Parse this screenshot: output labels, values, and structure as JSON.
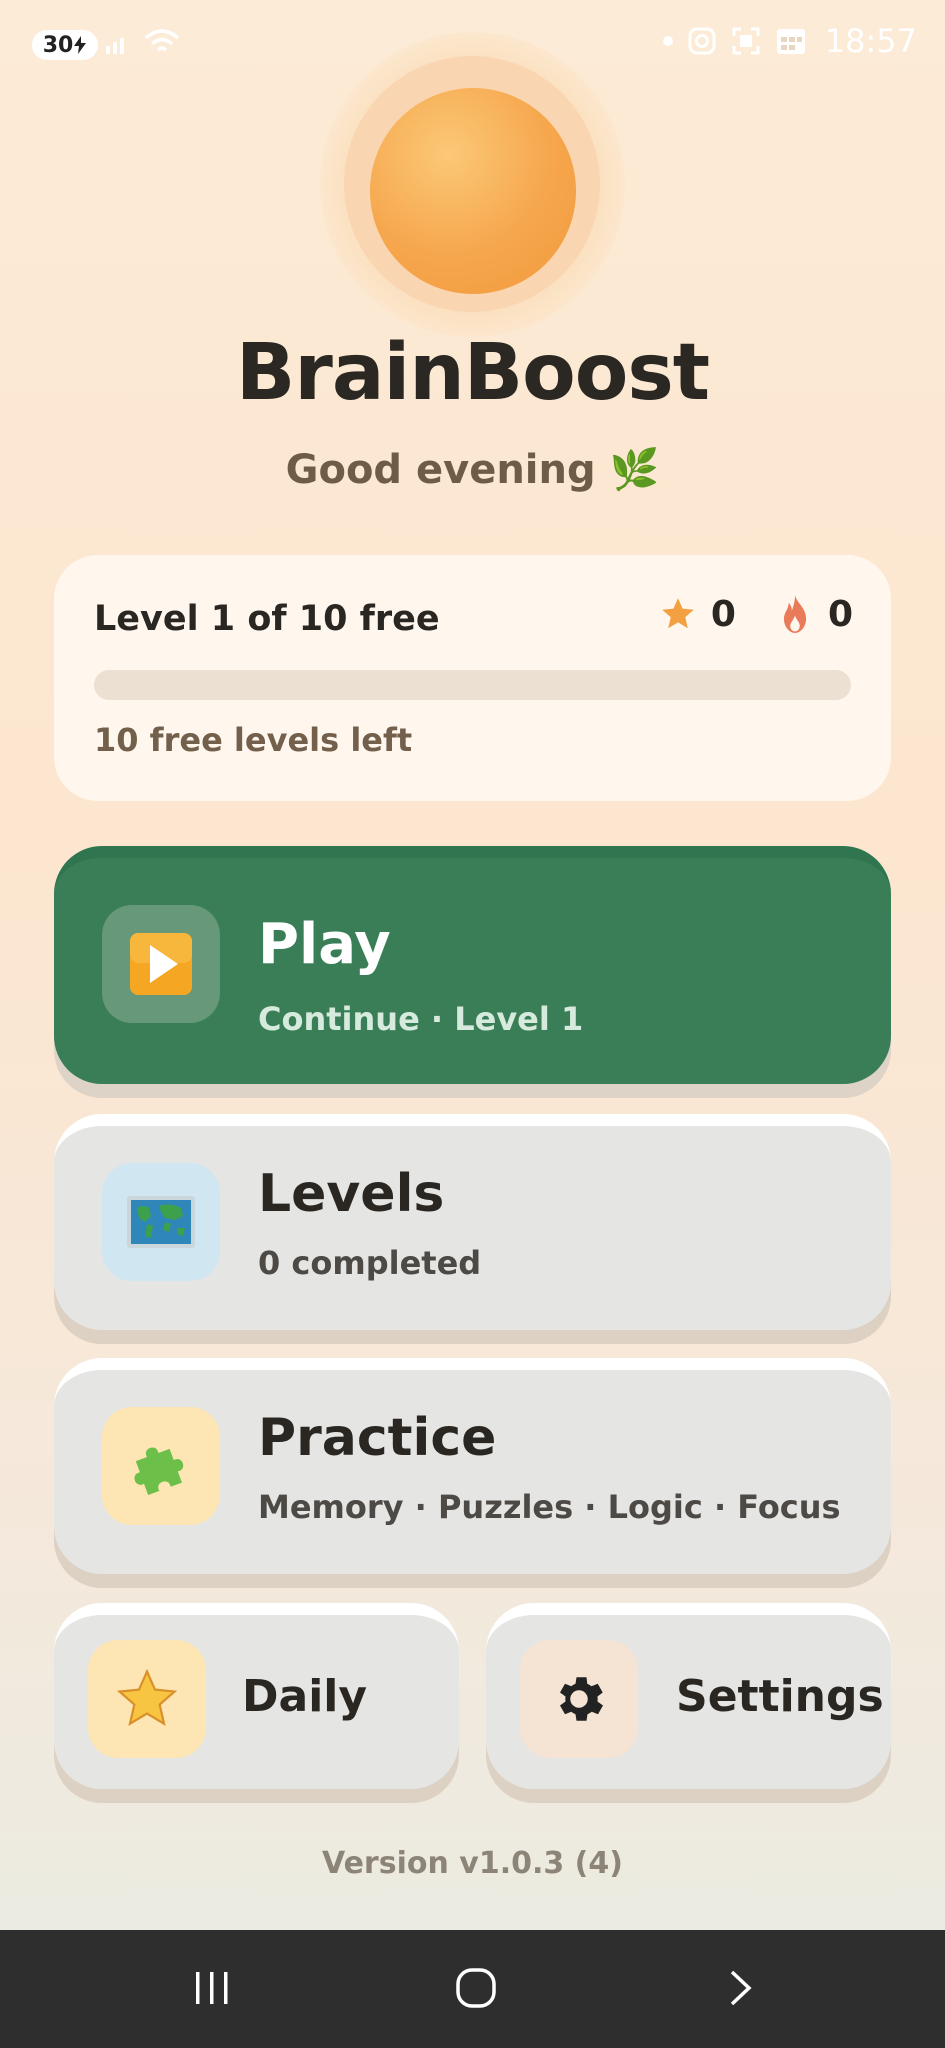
{
  "status_bar": {
    "battery": "30",
    "time": "18:57"
  },
  "app": {
    "title": "BrainBoost",
    "greeting": "Good evening 🌿"
  },
  "progress": {
    "level_text": "Level 1 of 10 free",
    "stars": "0",
    "streak": "0",
    "progress_fraction": 0,
    "free_left": "10 free levels left"
  },
  "menu": {
    "play": {
      "title": "Play",
      "subtitle": "Continue · Level 1",
      "icon": "play-icon"
    },
    "levels": {
      "title": "Levels",
      "subtitle": "0 completed",
      "icon": "map-icon"
    },
    "practice": {
      "title": "Practice",
      "subtitle": "Memory · Puzzles · Logic · Focus",
      "icon": "puzzle-icon"
    },
    "daily": {
      "label": "Daily",
      "icon": "star-icon"
    },
    "settings": {
      "label": "Settings",
      "icon": "gear-icon"
    }
  },
  "footer": {
    "version": "Version v1.0.3 (4)"
  },
  "colors": {
    "play_green": "#3a7e58",
    "accent_orange": "#f6a64c",
    "card_grey": "#e5e5e4"
  }
}
